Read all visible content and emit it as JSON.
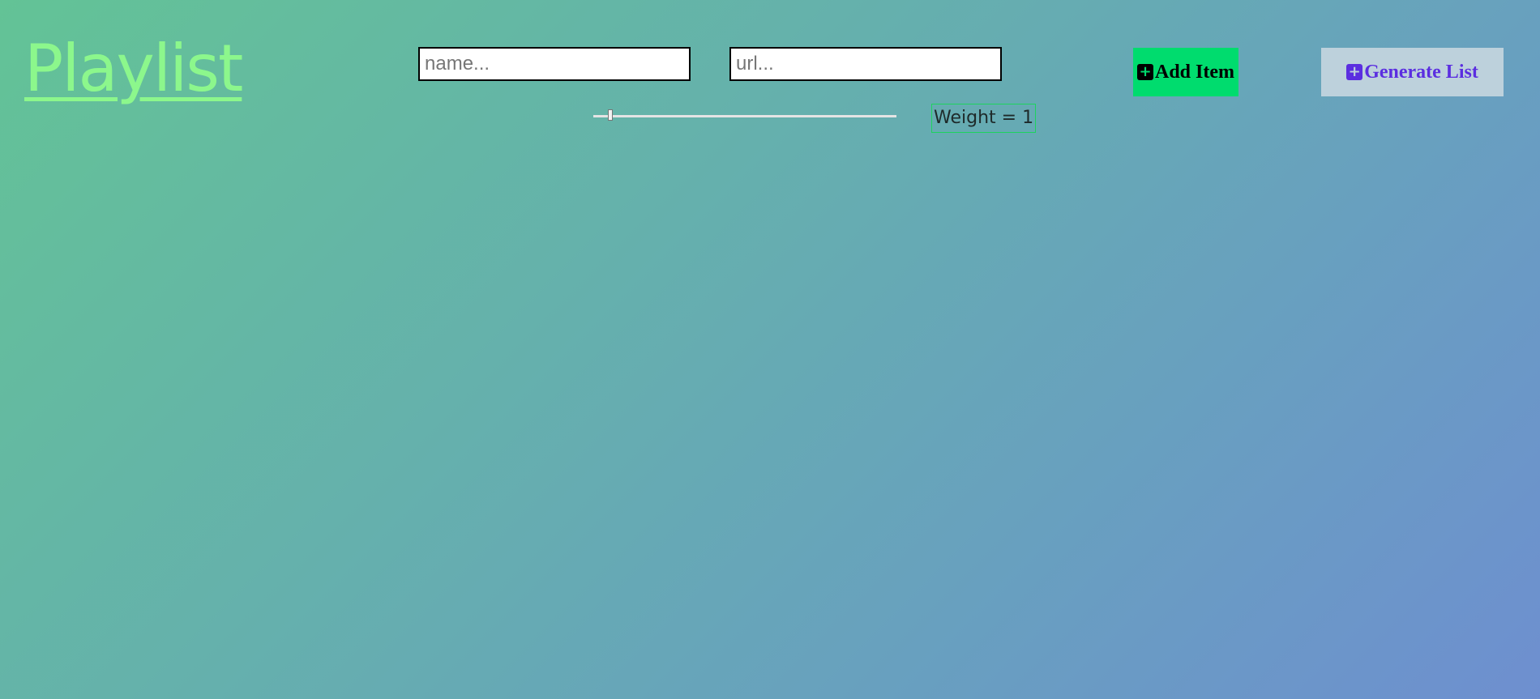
{
  "header": {
    "title": "Playlist"
  },
  "form": {
    "name_placeholder": "name...",
    "url_placeholder": "url...",
    "weight_text": "Weight = 1",
    "weight_slider": {
      "min": 1,
      "max": 100,
      "value": 1
    }
  },
  "buttons": {
    "add_label": "Add Item",
    "add_icon": "plus-square-icon",
    "generate_label": "Generate List",
    "generate_icon": "plus-square-icon"
  },
  "colors": {
    "title": "#8cf78c",
    "add_button_bg": "#00dc6e",
    "generate_button_bg": "#bdd1dc",
    "generate_button_text": "#5b2ee0",
    "weight_border": "#1dd35e",
    "background_start": "#63c396",
    "background_end": "#6e8fd0"
  }
}
